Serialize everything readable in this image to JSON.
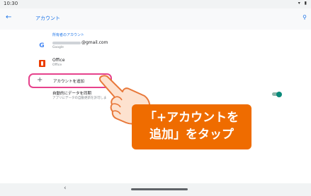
{
  "status_bar": {
    "time": "10:30",
    "icons": "▾ ▮"
  },
  "app_bar": {
    "back_icon": "←",
    "title": "アカウント",
    "search_icon": "⚲"
  },
  "content": {
    "section_header": "所有者のアカウント",
    "accounts": [
      {
        "icon": "google-icon",
        "title_suffix": "@gmail.com",
        "subtitle": "Google"
      },
      {
        "icon": "office-icon",
        "title": "Office",
        "subtitle": "Office"
      }
    ],
    "add_account": {
      "plus": "+",
      "label": "アカウントを追加"
    },
    "auto_sync": {
      "title": "自動的にデータを同期",
      "subtitle": "アプリにデータの自動更新を許可しま",
      "enabled": true
    }
  },
  "callout": {
    "line1": "「+アカウントを",
    "line2": "追加」をタップ",
    "color": "#ef6c00"
  },
  "highlight_color": "#e6428c",
  "nav_bar": {
    "back": "‹"
  }
}
